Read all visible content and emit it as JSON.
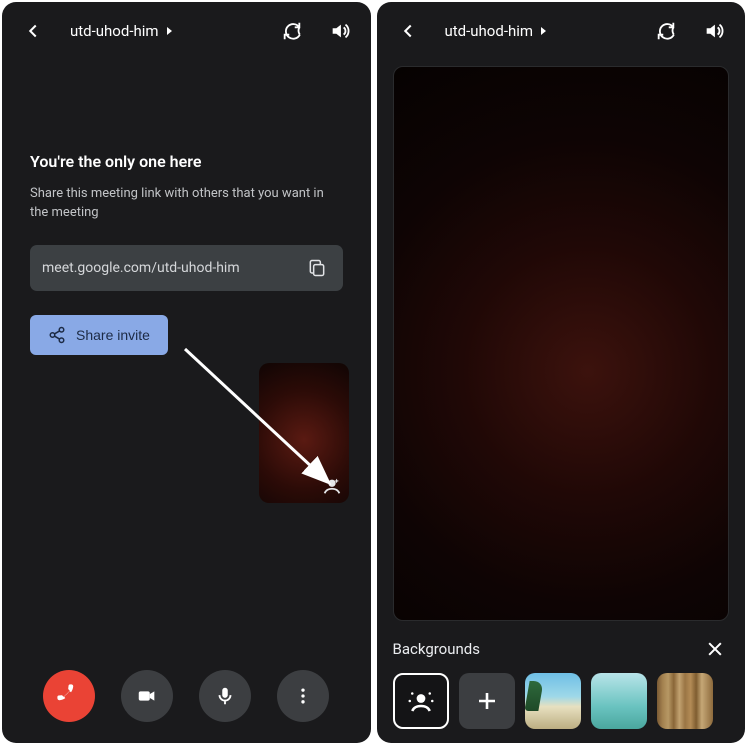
{
  "left": {
    "header": {
      "title": "utd-uhod-him"
    },
    "heading": "You're the only one here",
    "subtext": "Share this meeting link with others that you want in the meeting",
    "link": "meet.google.com/utd-uhod-him",
    "share_label": "Share invite"
  },
  "right": {
    "header": {
      "title": "utd-uhod-him"
    },
    "panel_title": "Backgrounds",
    "backgrounds": [
      {
        "name": "effects",
        "selected": true
      },
      {
        "name": "add"
      },
      {
        "name": "beach"
      },
      {
        "name": "sea"
      },
      {
        "name": "bookshelf"
      }
    ]
  }
}
